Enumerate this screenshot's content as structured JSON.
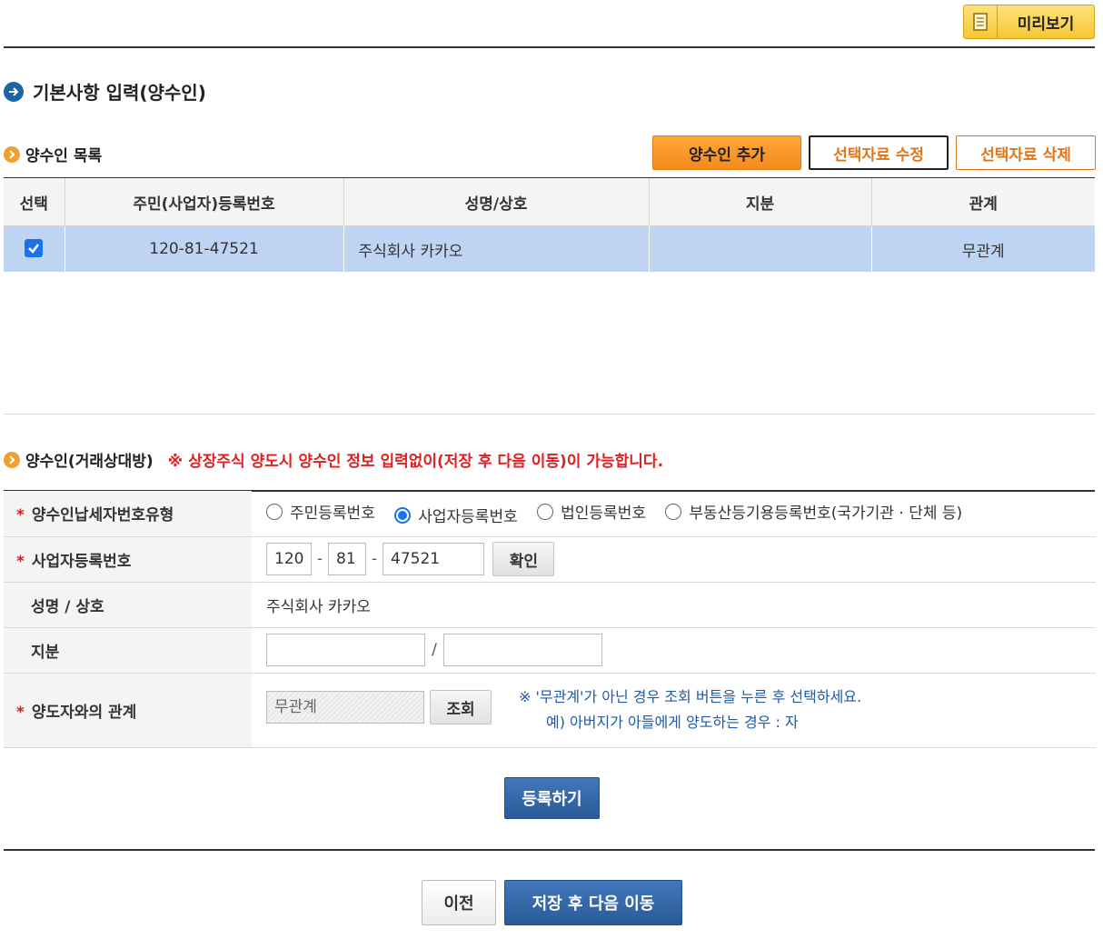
{
  "toolbar": {
    "preview_label": "미리보기"
  },
  "section_title": "기본사항 입력(양수인)",
  "list": {
    "title": "양수인 목록",
    "buttons": {
      "add": "양수인 추가",
      "edit": "선택자료 수정",
      "delete": "선택자료 삭제"
    },
    "columns": [
      "선택",
      "주민(사업자)등록번호",
      "성명/상호",
      "지분",
      "관계"
    ],
    "rows": [
      {
        "checked": true,
        "reg_no": "120-81-47521",
        "name": "주식회사 카카오",
        "share": "",
        "relation": "무관계"
      }
    ]
  },
  "form": {
    "title": "양수인(거래상대방)",
    "notice": "※ 상장주식 양도시 양수인 정보 입력없이(저장 후 다음 이동)이 가능합니다.",
    "type_label": "양수인납세자번호유형",
    "type_options": [
      "주민등록번호",
      "사업자등록번호",
      "법인등록번호",
      "부동산등기용등록번호(국가기관 · 단체 등)"
    ],
    "type_selected": "사업자등록번호",
    "bizno_label": "사업자등록번호",
    "bizno_parts": [
      "120",
      "81",
      "47521"
    ],
    "bizno_sep": "-",
    "confirm_label": "확인",
    "name_label": "성명 / 상호",
    "name_value": "주식회사 카카오",
    "share_label": "지분",
    "share_numerator": "",
    "share_denominator": "",
    "share_sep": "/",
    "relation_label": "양도자와의 관계",
    "relation_value": "무관계",
    "lookup_label": "조회",
    "hint_line1": "※ '무관계'가 아닌 경우 조회 버튼을 누른 후 선택하세요.",
    "hint_line2": "예) 아버지가 아들에게 양도하는 경우 : 자",
    "required_mark": "*",
    "register_label": "등록하기"
  },
  "footer": {
    "prev_label": "이전",
    "next_label": "저장 후 다음 이동"
  },
  "colors": {
    "selected_row": "#bfd3f2",
    "accent_orange": "#f38b1c",
    "primary_blue": "#2a5a98",
    "notice_red": "#e02020"
  }
}
